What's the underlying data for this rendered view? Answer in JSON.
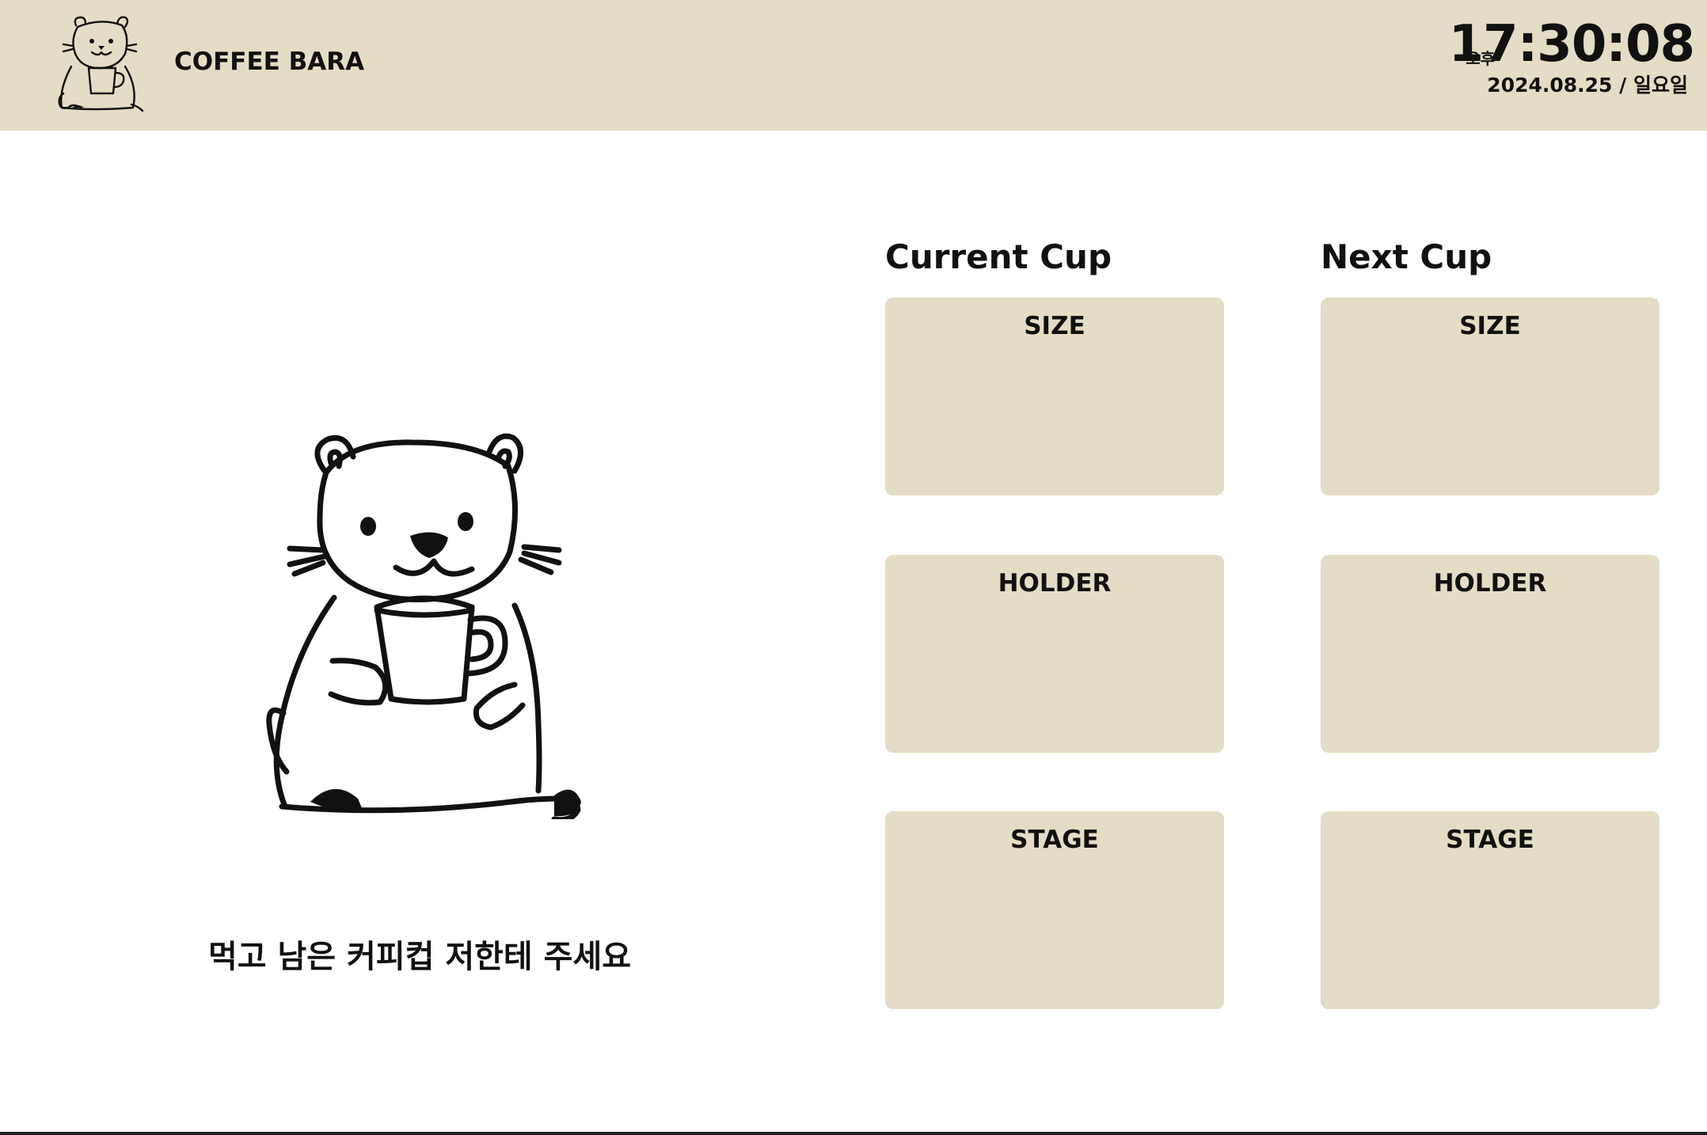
{
  "header": {
    "brand": "COFFEE BARA",
    "ampm": "오후",
    "time": "17:30:08",
    "date": "2024.08.25 / 일요일",
    "logo_icon": "capybara-with-cup-logo",
    "background_color": "#e5dcc5"
  },
  "main": {
    "mascot_icon": "capybara-holding-cup-illustration",
    "message": "먹고 남은 커피컵 저한테 주세요"
  },
  "current_cup": {
    "title": "Current Cup",
    "cards": [
      {
        "label": "SIZE",
        "value": ""
      },
      {
        "label": "HOLDER",
        "value": ""
      },
      {
        "label": "STAGE",
        "value": ""
      }
    ]
  },
  "next_cup": {
    "title": "Next Cup",
    "cards": [
      {
        "label": "SIZE",
        "value": ""
      },
      {
        "label": "HOLDER",
        "value": ""
      },
      {
        "label": "STAGE",
        "value": ""
      }
    ]
  },
  "colors": {
    "card_background": "#e5dcc5",
    "text": "#111111"
  }
}
